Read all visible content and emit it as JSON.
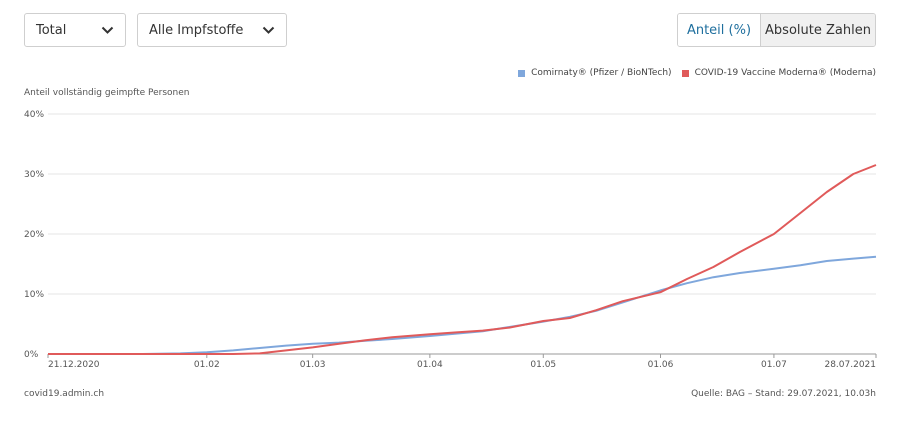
{
  "controls": {
    "select1": "Total",
    "select2": "Alle Impfstoffe",
    "toggle_active": "Anteil (%)",
    "toggle_inactive": "Absolute Zahlen"
  },
  "footer": {
    "left": "covid19.admin.ch",
    "right": "Quelle: BAG – Stand: 29.07.2021, 10.03h"
  },
  "chart_data": {
    "type": "line",
    "ylabel": "Anteil vollständig geimpfte Personen",
    "ylim": [
      0,
      40
    ],
    "yticks": [
      0,
      10,
      20,
      30,
      40
    ],
    "ytick_labels": [
      "0%",
      "10%",
      "20%",
      "30%",
      "40%"
    ],
    "xlim": [
      "2020-12-21",
      "2021-07-28"
    ],
    "xticks": [
      {
        "date": "2020-12-21",
        "label": "21.12.2020"
      },
      {
        "date": "2021-02-01",
        "label": "01.02"
      },
      {
        "date": "2021-03-01",
        "label": "01.03"
      },
      {
        "date": "2021-04-01",
        "label": "01.04"
      },
      {
        "date": "2021-05-01",
        "label": "01.05"
      },
      {
        "date": "2021-06-01",
        "label": "01.06"
      },
      {
        "date": "2021-07-01",
        "label": "01.07"
      },
      {
        "date": "2021-07-28",
        "label": "28.07.2021"
      }
    ],
    "grid": true,
    "legend_position": "top-right",
    "series": [
      {
        "name": "Comirnaty® (Pfizer / BioNTech)",
        "color": "#7fa7dc",
        "points": [
          [
            "2020-12-21",
            0
          ],
          [
            "2021-01-15",
            0
          ],
          [
            "2021-01-25",
            0.1
          ],
          [
            "2021-02-01",
            0.3
          ],
          [
            "2021-02-08",
            0.6
          ],
          [
            "2021-02-15",
            1.0
          ],
          [
            "2021-02-22",
            1.4
          ],
          [
            "2021-03-01",
            1.7
          ],
          [
            "2021-03-08",
            1.9
          ],
          [
            "2021-03-15",
            2.2
          ],
          [
            "2021-03-22",
            2.5
          ],
          [
            "2021-04-01",
            3.0
          ],
          [
            "2021-04-08",
            3.4
          ],
          [
            "2021-04-15",
            3.8
          ],
          [
            "2021-04-22",
            4.5
          ],
          [
            "2021-05-01",
            5.4
          ],
          [
            "2021-05-08",
            6.2
          ],
          [
            "2021-05-15",
            7.2
          ],
          [
            "2021-05-22",
            8.6
          ],
          [
            "2021-06-01",
            10.6
          ],
          [
            "2021-06-08",
            11.8
          ],
          [
            "2021-06-15",
            12.8
          ],
          [
            "2021-06-22",
            13.5
          ],
          [
            "2021-07-01",
            14.2
          ],
          [
            "2021-07-08",
            14.8
          ],
          [
            "2021-07-15",
            15.5
          ],
          [
            "2021-07-22",
            15.9
          ],
          [
            "2021-07-28",
            16.2
          ]
        ]
      },
      {
        "name": "COVID-19 Vaccine Moderna® (Moderna)",
        "color": "#e05a5a",
        "points": [
          [
            "2020-12-21",
            0
          ],
          [
            "2021-02-08",
            0
          ],
          [
            "2021-02-15",
            0.1
          ],
          [
            "2021-02-22",
            0.6
          ],
          [
            "2021-03-01",
            1.1
          ],
          [
            "2021-03-08",
            1.7
          ],
          [
            "2021-03-15",
            2.3
          ],
          [
            "2021-03-22",
            2.8
          ],
          [
            "2021-04-01",
            3.3
          ],
          [
            "2021-04-08",
            3.6
          ],
          [
            "2021-04-15",
            3.9
          ],
          [
            "2021-04-22",
            4.4
          ],
          [
            "2021-05-01",
            5.5
          ],
          [
            "2021-05-08",
            6.0
          ],
          [
            "2021-05-15",
            7.3
          ],
          [
            "2021-05-22",
            8.8
          ],
          [
            "2021-06-01",
            10.3
          ],
          [
            "2021-06-08",
            12.5
          ],
          [
            "2021-06-15",
            14.5
          ],
          [
            "2021-06-22",
            17.0
          ],
          [
            "2021-07-01",
            20.0
          ],
          [
            "2021-07-08",
            23.5
          ],
          [
            "2021-07-15",
            27.0
          ],
          [
            "2021-07-22",
            30.0
          ],
          [
            "2021-07-28",
            31.5
          ]
        ]
      }
    ]
  }
}
